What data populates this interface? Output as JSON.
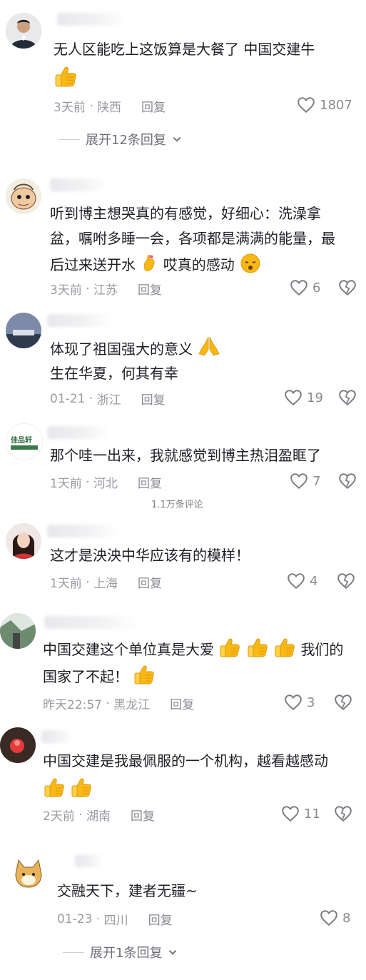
{
  "comments": [
    {
      "text_lines": [
        "无人区能吃上这饭算是大餐了 中国交建牛"
      ],
      "meta_time": "3天前",
      "meta_location": "陕西",
      "reply": "回复",
      "likes": "1807",
      "expand": "展开12条回复"
    },
    {
      "text_lines": [
        "听到博主想哭真的有感觉，好细心：洗澡拿",
        "盆，嘱咐多睡一会，各项都是满满的能量，最",
        "后过来送开水",
        "哎真的感动"
      ],
      "meta_time": "3天前",
      "meta_location": "江苏",
      "reply": "回复",
      "likes": "6"
    },
    {
      "text_lines": [
        "体现了祖国强大的意义",
        "生在华夏，何其有幸"
      ],
      "meta_time": "01-21",
      "meta_location": "浙江",
      "reply": "回复",
      "likes": "19"
    },
    {
      "text_lines": [
        "那个哇一出来，我就感觉到博主热泪盈眶了"
      ],
      "meta_time": "1天前",
      "meta_location": "河北",
      "reply": "回复",
      "likes": "7"
    },
    {
      "text_lines": [
        "这才是泱泱中华应该有的模样！"
      ],
      "meta_time": "1天前",
      "meta_location": "上海",
      "reply": "回复",
      "likes": "4"
    },
    {
      "text_lines": [
        "中国交建这个单位真是大爱",
        "我们的",
        "国家了不起！"
      ],
      "meta_time": "昨天22:57",
      "meta_location": "黑龙江",
      "reply": "回复",
      "likes": "3"
    },
    {
      "text_lines": [
        "中国交建是我最佩服的一个机构，越看越感动"
      ],
      "meta_time": "2天前",
      "meta_location": "湖南",
      "reply": "回复",
      "likes": "11"
    },
    {
      "text_lines": [
        "交融天下，建者无疆~"
      ],
      "meta_time": "01-23",
      "meta_location": "四川",
      "reply": "回复",
      "likes": "8",
      "expand": "展开1条回复"
    }
  ],
  "overlay_count": "1.1万条评论",
  "avatar_badge_text": "佳品轩",
  "colors": {
    "meta": "#9a9aa3",
    "text": "#1f1f25",
    "emoji": "#f6b21a"
  },
  "icons": [
    "heart-icon",
    "dislike-heart-icon",
    "thumbs-up-emoji",
    "pray-emoji",
    "chevron-down-icon"
  ]
}
